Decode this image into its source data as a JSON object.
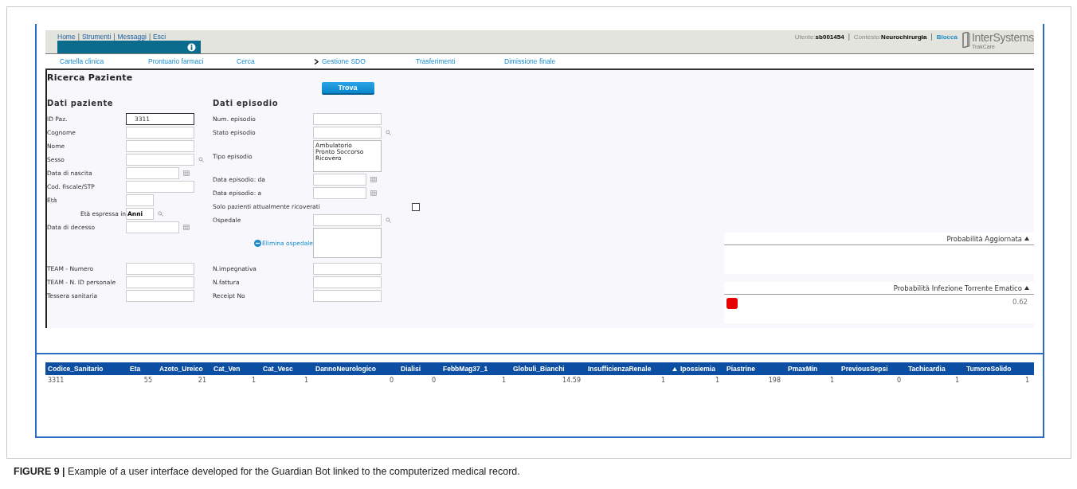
{
  "header": {
    "links": [
      {
        "label": "Home"
      },
      {
        "sep": "|",
        "label": "Strumenti"
      },
      {
        "sep": "|",
        "label": "Messaggi"
      },
      {
        "sep": "|",
        "label": "Esci"
      }
    ],
    "user_items": [
      {
        "kind": "field",
        "label": "Utente:",
        "value": "sb001454"
      },
      {
        "kind": "sep",
        "text": "|"
      },
      {
        "kind": "field",
        "label": "Contesto:",
        "value": "Neurochirurgia"
      },
      {
        "kind": "sep",
        "text": "|"
      },
      {
        "kind": "link",
        "text": "Blocca"
      }
    ],
    "logo": {
      "name": "InterSystems",
      "product": "TrakCare"
    }
  },
  "nav": [
    {
      "label": "Cartella clinica",
      "selected": false
    },
    {
      "label": "Prontuario farmaci",
      "selected": false
    },
    {
      "label": "Cerca",
      "selected": false
    },
    {
      "label": "Gestione SDO",
      "selected": true
    },
    {
      "label": "Trasferimenti",
      "selected": false
    },
    {
      "label": "Dimissione finale",
      "selected": false
    }
  ],
  "title": "Ricerca Paziente",
  "search_button": "Trova",
  "patient": {
    "heading": "Dati paziente",
    "fields": [
      {
        "label": "ID Paz.",
        "kind": "text",
        "value": "3311",
        "focused": true
      },
      {
        "label": "Cognome",
        "kind": "text",
        "focused": false
      },
      {
        "label": "Nome",
        "kind": "text",
        "focused": false
      },
      {
        "label": "Sesso",
        "kind": "lookup"
      },
      {
        "label": "Data di nascita",
        "kind": "date"
      },
      {
        "label": "Cod. fiscale/STP",
        "kind": "text",
        "focused": false
      },
      {
        "label": "Età",
        "kind": "short"
      },
      {
        "label": "Età espressa in",
        "kind": "unit",
        "value": "Anni"
      },
      {
        "label": "Data di decesso",
        "kind": "date"
      }
    ],
    "team_fields": [
      {
        "label": "TEAM - Numero",
        "kind": "text",
        "focused": false
      },
      {
        "label": "TEAM - N. ID personale",
        "kind": "text",
        "focused": false
      },
      {
        "label": "Tessera sanitaria",
        "kind": "text",
        "focused": false
      }
    ]
  },
  "episode": {
    "heading": "Dati episodio",
    "fields": [
      {
        "label": "Num. episodio",
        "kind": "text",
        "focused": false
      },
      {
        "label": "Stato episodio",
        "kind": "lookup"
      },
      {
        "label": "Tipo episodio",
        "kind": "listbox",
        "options": [
          "Ambulatorio",
          "Pronto Soccorso",
          "Ricovero"
        ]
      },
      {
        "label": "Data episodio: da",
        "kind": "date"
      },
      {
        "label": "Data episodio: a",
        "kind": "date"
      },
      {
        "label": "Solo pazienti attualmente ricoverati",
        "kind": "checkbox",
        "checked": false
      },
      {
        "label": "Ospedale",
        "kind": "lookup"
      },
      {
        "kind": "hospital-list",
        "action": "Elimina ospedale"
      }
    ],
    "billing_fields": [
      {
        "label": "N.impegnativa",
        "kind": "text",
        "focused": false
      },
      {
        "label": "N.fattura",
        "kind": "text",
        "focused": false
      },
      {
        "label": "Receipt No",
        "kind": "text",
        "focused": false
      }
    ]
  },
  "probability_panels": [
    {
      "title": "Probabilità Aggiornata",
      "sorted": true
    },
    {
      "title": "Probabilità Infezione Torrente Ematico",
      "sorted": true,
      "color": "#e60000",
      "value": "0.62"
    }
  ],
  "table": {
    "columns": [
      {
        "label": "Codice_Sanitario",
        "sorted": false
      },
      {
        "label": "Eta",
        "sorted": false
      },
      {
        "label": "Azoto_Ureico",
        "sorted": false
      },
      {
        "label": "Cat_Ven",
        "sorted": false
      },
      {
        "label": "Cat_Vesc",
        "sorted": false
      },
      {
        "label": "DannoNeurologico",
        "sorted": false
      },
      {
        "label": "Dialisi",
        "sorted": false
      },
      {
        "label": "FebbMag37_1",
        "sorted": false
      },
      {
        "label": "Globuli_Bianchi",
        "sorted": false
      },
      {
        "label": "InsufficienzaRenale",
        "sorted": false
      },
      {
        "label": "Ipossiemia",
        "sorted": true
      },
      {
        "label": "Piastrine",
        "sorted": false
      },
      {
        "label": "PmaxMin",
        "sorted": false
      },
      {
        "label": "PreviousSepsi",
        "sorted": false
      },
      {
        "label": "Tachicardia",
        "sorted": false
      },
      {
        "label": "TumoreSolido",
        "sorted": false
      }
    ],
    "rows": [
      [
        "3311",
        "55",
        "21",
        "1",
        "1",
        "0",
        "0",
        "1",
        "14.59",
        "1",
        "1",
        "198",
        "1",
        "0",
        "1",
        "1"
      ]
    ]
  },
  "caption": "**FIGURE 9 |** Example of a user interface developed for the Guardian Bot linked to the computerized medical record."
}
